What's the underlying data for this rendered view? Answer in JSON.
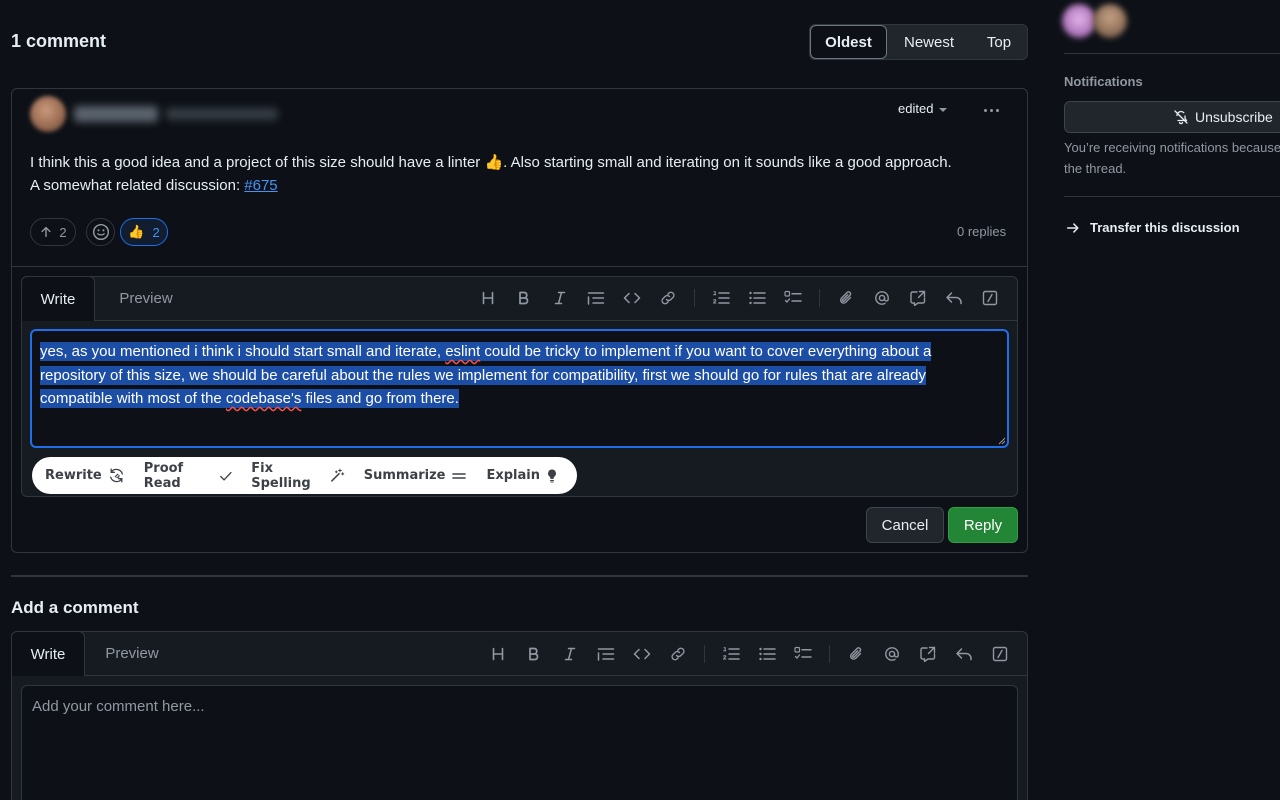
{
  "discussion": {
    "comment_count_label": "1 comment",
    "sort_options": [
      "Oldest",
      "Newest",
      "Top"
    ],
    "sort_selected": "Oldest"
  },
  "comment": {
    "edited_label": "edited",
    "body_line1": "I think this a good idea and a project of this size should have a linter 👍. Also starting small and iterating on it sounds like a good approach.",
    "body_line2_prefix": "A somewhat related discussion: ",
    "body_link": "#675",
    "upvotes": "2",
    "reaction_emoji": "👍",
    "reaction_count": "2",
    "replies_label": "0 replies"
  },
  "reply_editor": {
    "tab_write": "Write",
    "tab_preview": "Preview",
    "text_part1": "yes, as you mentioned i think i should start small and iterate, ",
    "text_misspelled1": "eslint",
    "text_part2": " could be tricky to implement if you want to cover everything about a repository of this size, we should be careful about the rules we implement for compatibility, first we should go for rules that are already compatible with most of the ",
    "text_misspelled2": "codebase's",
    "text_part3": " files and go from there. ",
    "ai_actions": [
      "Rewrite",
      "Proof Read",
      "Fix Spelling",
      "Summarize",
      "Explain"
    ],
    "cancel_label": "Cancel",
    "reply_label": "Reply"
  },
  "toolbar_icons": [
    "heading-icon",
    "bold-icon",
    "italic-icon",
    "quote-icon",
    "code-icon",
    "link-icon",
    "numbered-list-icon",
    "bulleted-list-icon",
    "task-list-icon",
    "attach-icon",
    "mention-icon",
    "reference-icon",
    "undo-reply-icon",
    "slash-command-icon"
  ],
  "add_comment": {
    "title": "Add a comment",
    "tab_write": "Write",
    "tab_preview": "Preview",
    "placeholder": "Add your comment here..."
  },
  "sidebar": {
    "notifications_title": "Notifications",
    "unsubscribe_label": "Unsubscribe",
    "notifications_desc_line1": "You’re receiving notifications because",
    "notifications_desc_line2": "the thread.",
    "transfer_label": "Transfer this discussion"
  },
  "colors": {
    "background": "#0d1117",
    "accent_blue": "#1f6feb",
    "link_blue": "#4493f8",
    "reply_green": "#238636",
    "selection": "#1d4ea6"
  }
}
